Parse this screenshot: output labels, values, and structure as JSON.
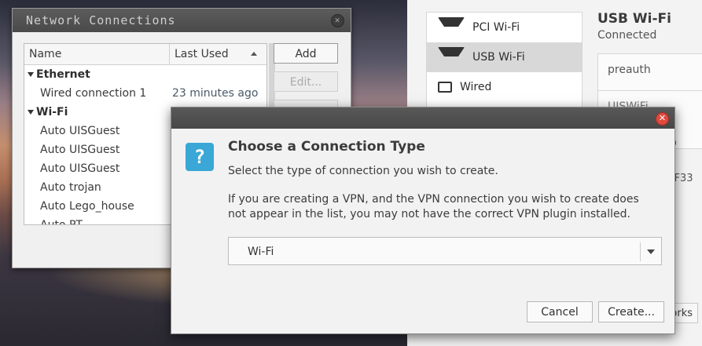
{
  "settings": {
    "devices": [
      {
        "label": "PCI Wi-Fi",
        "icon": "wifi-icon",
        "selected": false
      },
      {
        "label": "USB Wi-Fi",
        "icon": "wifi-icon",
        "selected": true
      },
      {
        "label": "Wired",
        "icon": "wired-icon",
        "selected": false
      }
    ],
    "title": "USB Wi-Fi",
    "status": "Connected",
    "detail_network": "preauth",
    "detail_ssid_partial": "UISWiFi",
    "mac_partial": "FF33",
    "networks_button_partial": "orks"
  },
  "network_connections": {
    "title": "Network Connections",
    "columns": [
      "Name",
      "Last Used"
    ],
    "groups": [
      {
        "label": "Ethernet",
        "items": [
          {
            "name": "Wired connection 1",
            "last_used": "23 minutes ago"
          }
        ]
      },
      {
        "label": "Wi-Fi",
        "items": [
          {
            "name": "Auto UISGuest",
            "last_used": ""
          },
          {
            "name": "Auto UISGuest",
            "last_used": ""
          },
          {
            "name": "Auto UISGuest",
            "last_used": ""
          },
          {
            "name": "Auto trojan",
            "last_used": ""
          },
          {
            "name": "Auto Lego_house",
            "last_used": ""
          },
          {
            "name": "Auto PT...",
            "last_used": ""
          }
        ]
      }
    ],
    "buttons": {
      "add": "Add",
      "edit": "Edit..."
    }
  },
  "dialog": {
    "heading": "Choose a Connection Type",
    "line1": "Select the type of connection you wish to create.",
    "line2": "If you are creating a VPN, and the VPN connection you wish to create does not appear in the list, you may not have the correct VPN plugin installed.",
    "selected_type": "Wi-Fi",
    "cancel_label": "Cancel",
    "create_label": "Create...",
    "icon": "question-icon",
    "accent_color": "#3aa7d6"
  }
}
